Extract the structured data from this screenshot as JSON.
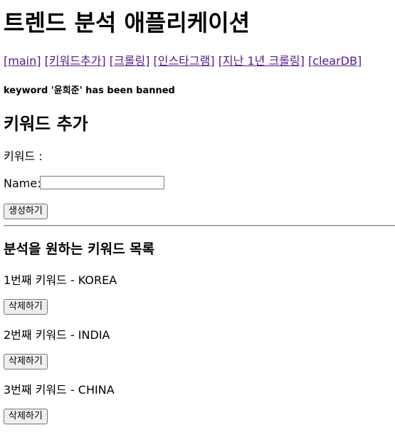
{
  "page": {
    "title": "트렌드 분석 애플리케이션"
  },
  "nav": {
    "links": [
      "[main]",
      "[키워드추가]",
      "[크롤링]",
      "[인스타그램]",
      "[지난 1년 크롤링]",
      "[clearDB]"
    ]
  },
  "message": "keyword '윤희준' has been banned",
  "add_section": {
    "heading": "키워드 추가",
    "keyword_label": "키워드 :",
    "name_label": "Name:",
    "name_value": "",
    "submit_label": "생성하기"
  },
  "list_section": {
    "heading": "분석을 원하는 키워드 목록",
    "items": [
      {
        "text": "1번째 키워드 - KOREA",
        "delete_label": "삭제하기"
      },
      {
        "text": "2번째 키워드 - INDIA",
        "delete_label": "삭제하기"
      },
      {
        "text": "3번째 키워드 - CHINA",
        "delete_label": "삭제하기"
      }
    ]
  },
  "colors": {
    "visited_link": "#551a8b",
    "button_bg": "#efefef",
    "button_border": "#767676"
  }
}
